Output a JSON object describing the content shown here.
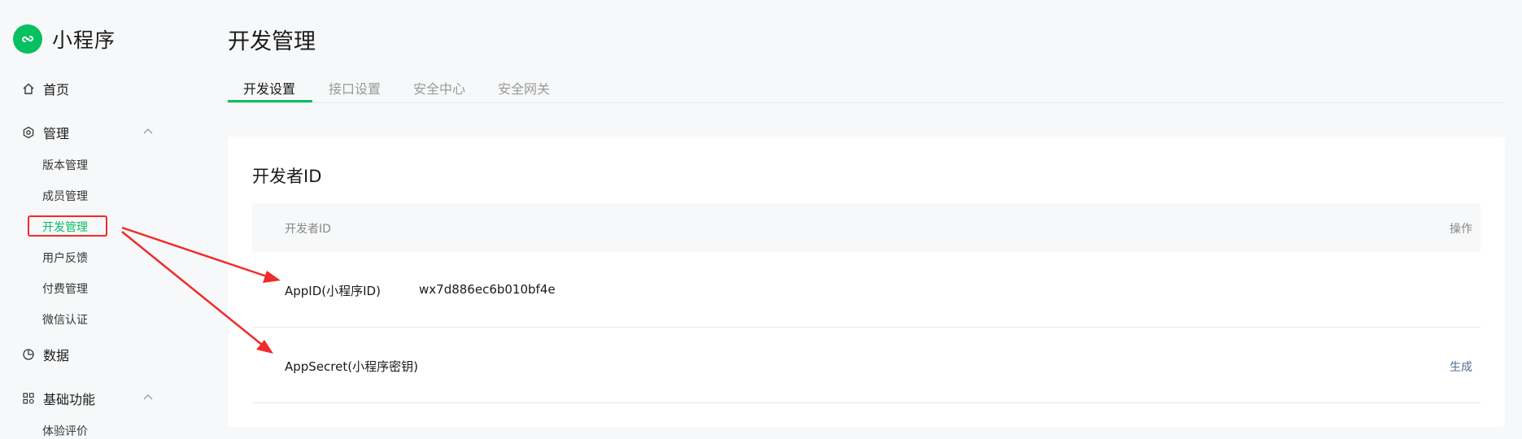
{
  "brand": {
    "name": "小程序"
  },
  "nav": {
    "home": "首页",
    "manage": "管理",
    "manage_items": [
      "版本管理",
      "成员管理",
      "开发管理",
      "用户反馈",
      "付费管理",
      "微信认证"
    ],
    "data": "数据",
    "basic": "基础功能",
    "basic_items": [
      "体验评价"
    ]
  },
  "page": {
    "title": "开发管理"
  },
  "tabs": [
    "开发设置",
    "接口设置",
    "安全中心",
    "安全网关"
  ],
  "card": {
    "title": "开发者ID",
    "columns": {
      "id": "开发者ID",
      "action": "操作"
    },
    "rows": [
      {
        "label": "AppID(小程序ID)",
        "value": "wx7d886ec6b010bf4e",
        "action": ""
      },
      {
        "label": "AppSecret(小程序密钥)",
        "value": "",
        "action": "生成"
      }
    ]
  },
  "colors": {
    "accent": "#07c160",
    "link": "#576b95",
    "annotation": "#f02b2b"
  },
  "icons": [
    "mini-program-logo-icon",
    "home-icon",
    "settings-hexagon-icon",
    "chevron-up-icon",
    "pie-chart-icon",
    "grid-apps-icon"
  ]
}
